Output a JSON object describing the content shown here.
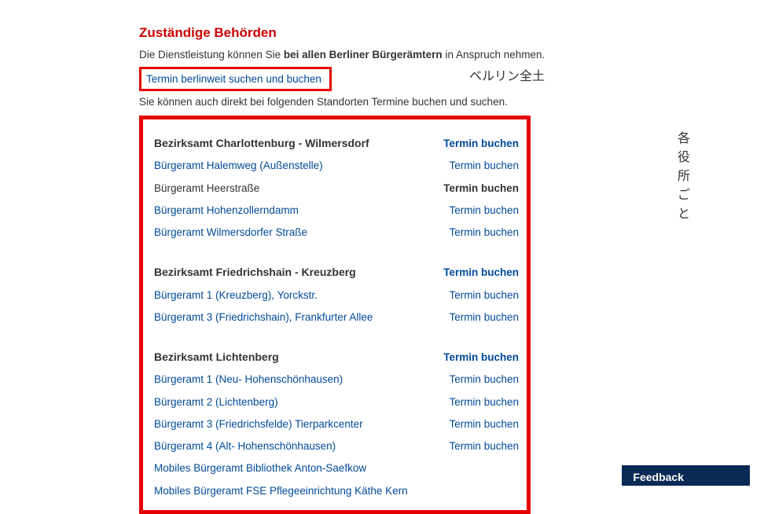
{
  "heading": "Zuständige Behörden",
  "intro_before": "Die Dienstleistung können Sie ",
  "intro_bold": "bei allen Berliner Bürgerämtern",
  "intro_after": " in Anspruch nehmen.",
  "berlinweit_link": "Termin berlinweit suchen und buchen",
  "annotation_berlinweit": "ベルリン全土",
  "subintro": "Sie können auch direkt bei folgenden Standorten Termine buchen und suchen.",
  "annotation_offices": "各役所ごと",
  "action_label": "Termin buchen",
  "districts": [
    {
      "name": "Bezirksamt Charlottenburg - Wilmersdorf",
      "offices": [
        {
          "name": "Bürgeramt Halemweg (Außenstelle)",
          "has_link": true,
          "has_action": true
        },
        {
          "name": "Bürgeramt Heerstraße",
          "has_link": false,
          "has_action": true,
          "action_bold": true
        },
        {
          "name": "Bürgeramt Hohenzollerndamm",
          "has_link": true,
          "has_action": true
        },
        {
          "name": "Bürgeramt Wilmersdorfer Straße",
          "has_link": true,
          "has_action": true
        }
      ]
    },
    {
      "name": "Bezirksamt Friedrichshain - Kreuzberg",
      "offices": [
        {
          "name": "Bürgeramt 1 (Kreuzberg), Yorckstr.",
          "has_link": true,
          "has_action": true
        },
        {
          "name": "Bürgeramt 3 (Friedrichshain), Frankfurter Allee",
          "has_link": true,
          "has_action": true
        }
      ]
    },
    {
      "name": "Bezirksamt Lichtenberg",
      "offices": [
        {
          "name": "Bürgeramt 1 (Neu- Hohenschönhausen)",
          "has_link": true,
          "has_action": true
        },
        {
          "name": "Bürgeramt 2 (Lichtenberg)",
          "has_link": true,
          "has_action": true
        },
        {
          "name": "Bürgeramt 3 (Friedrichsfelde) Tierparkcenter",
          "has_link": true,
          "has_action": true
        },
        {
          "name": "Bürgeramt 4 (Alt- Hohenschönhausen)",
          "has_link": true,
          "has_action": true
        },
        {
          "name": "Mobiles Bürgeramt Bibliothek Anton-Saefkow",
          "has_link": true,
          "has_action": false
        },
        {
          "name": "Mobiles Bürgeramt FSE Pflegeeinrichtung Käthe Kern",
          "has_link": true,
          "has_action": false
        }
      ]
    }
  ],
  "feedback": "Feedback"
}
